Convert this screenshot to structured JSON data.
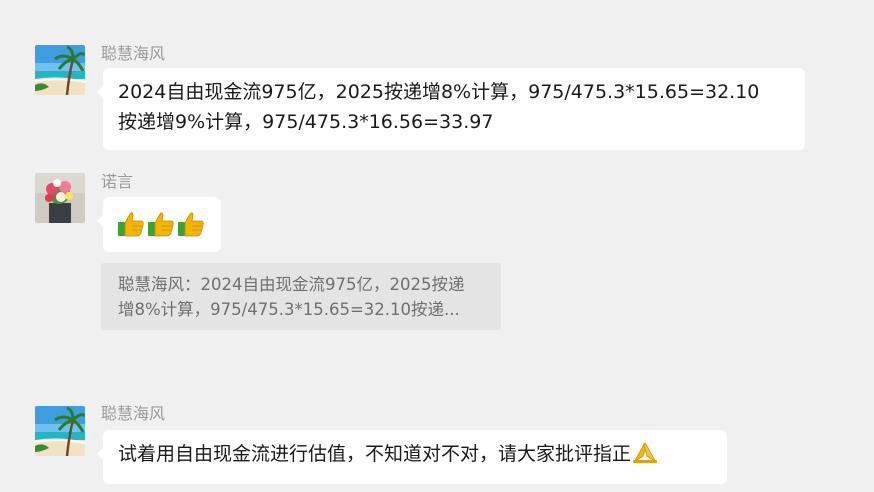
{
  "messages": [
    {
      "sender": "聪慧海风",
      "avatar_icon": "beach-palm-avatar",
      "lines": [
        "2024自由现金流975亿，2025按递增8%计算，975/475.3*15.65=32.10",
        "按递增9%计算，975/475.3*16.56=33.97"
      ]
    },
    {
      "sender": "诺言",
      "avatar_icon": "flower-bouquet-avatar",
      "emoji": [
        "👍",
        "👍",
        "👍"
      ],
      "emoji_icon": "thumbs-up-icon",
      "quote": {
        "line1": "聪慧海风：2024自由现金流975亿，2025按递",
        "line2": "增8%计算，975/475.3*15.65=32.10按递..."
      }
    },
    {
      "sender": "聪慧海风",
      "avatar_icon": "beach-palm-avatar",
      "text": "试着用自由现金流进行估值，不知道对不对，请大家批评指正",
      "trailing_emoji": "🙏",
      "trailing_emoji_icon": "praying-hands-icon"
    }
  ],
  "colors": {
    "background": "#f0f0f0",
    "bubble": "#ffffff",
    "quote_bg": "#e4e4e4",
    "sender_text": "#9a9a9a",
    "thumb": "#f4b400",
    "cuff": "#3aa335"
  }
}
